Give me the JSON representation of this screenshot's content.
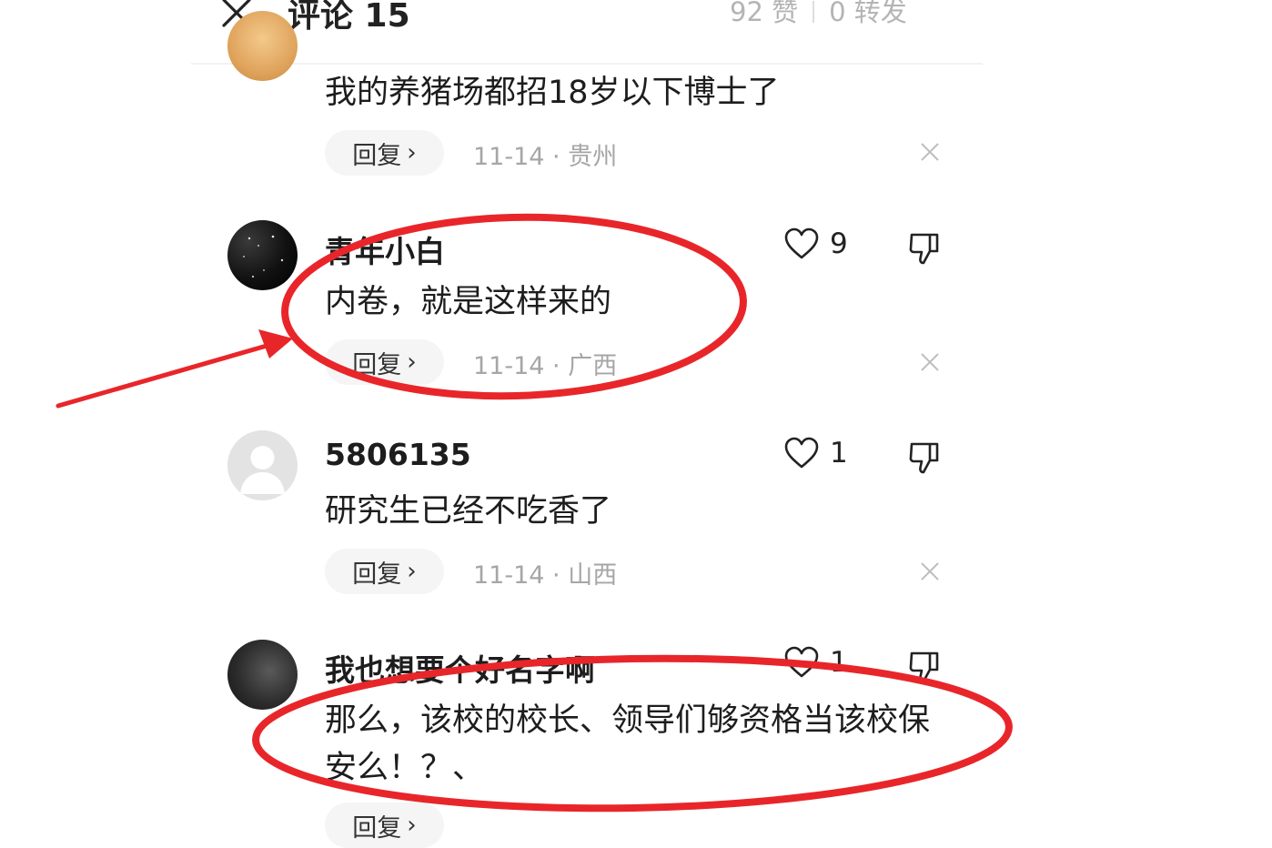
{
  "header": {
    "title": "评论 15",
    "likes": "92 赞",
    "reposts": "0 转发"
  },
  "comments": [
    {
      "name": "",
      "text": "我的养猪场都招18岁以下博士了",
      "reply_label": "回复",
      "meta": "11-14 · 贵州",
      "likes": ""
    },
    {
      "name": "青年小白",
      "text": "内卷，就是这样来的",
      "reply_label": "回复",
      "meta": "11-14 · 广西",
      "likes": "9"
    },
    {
      "name": "5806135",
      "text": "研究生已经不吃香了",
      "reply_label": "回复",
      "meta": "11-14 · 山西",
      "likes": "1"
    },
    {
      "name": "我也想要个好名字啊",
      "text": "那么，该校的校长、领导们够资格当该校保安么！？、",
      "reply_label": "回复",
      "meta": "",
      "likes": "1"
    }
  ],
  "colors": {
    "annotation": "#e8262a",
    "meta_text": "#a6a6a6",
    "reply_bg": "#f5f5f5"
  },
  "icons": [
    "close-icon",
    "heart-icon",
    "thumbs-down-icon",
    "dismiss-icon",
    "chevron-right-icon"
  ]
}
